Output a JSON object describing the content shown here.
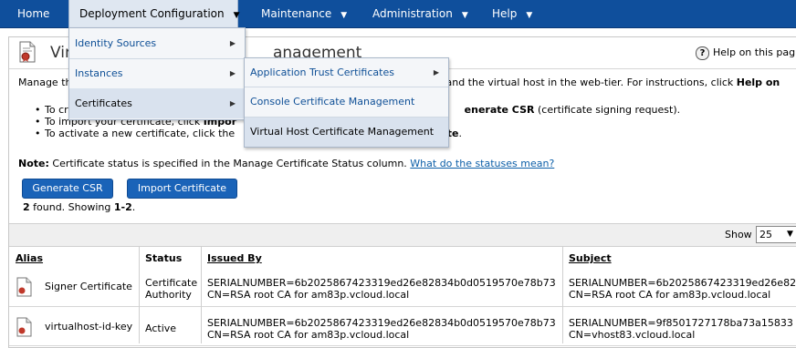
{
  "nav": {
    "items": [
      {
        "label": "Home"
      },
      {
        "label": "Deployment Configuration"
      },
      {
        "label": "Maintenance"
      },
      {
        "label": "Administration"
      },
      {
        "label": "Help"
      }
    ],
    "caret": "▼"
  },
  "menu1": {
    "items": [
      {
        "label": "Identity Sources",
        "arrow": "▶"
      },
      {
        "label": "Instances",
        "arrow": "▶"
      },
      {
        "label": "Certificates",
        "arrow": "▶"
      }
    ]
  },
  "menu2": {
    "items": [
      {
        "label": "Application Trust Certificates",
        "arrow": "▶"
      },
      {
        "label": "Console Certificate Management"
      },
      {
        "label": "Virtual Host Certificate Management"
      }
    ]
  },
  "page": {
    "title_prefix": "Vir",
    "title_suffix": "anagement",
    "help_label": "Help on this pag",
    "help_glyph": "?",
    "intro_prefix": "Manage th",
    "intro_suffix": "and the virtual host in the web-tier. For instructions, click ",
    "intro_bold": "Help on",
    "bullets": [
      {
        "pre": "To cr",
        "bold": "enerate CSR",
        "post": " (certificate signing request)."
      },
      {
        "pre": "To import your certificate, click ",
        "bold": "Impor",
        "post": ""
      },
      {
        "pre": "To activate a new certificate, click the",
        "bold": "vate",
        "post": "."
      }
    ],
    "note_label": "Note:",
    "note_text": " Certificate status is specified in the Manage Certificate Status column. ",
    "note_link": "What do the statuses mean?",
    "btn_generate": "Generate CSR",
    "btn_import": "Import Certificate",
    "found_count": "2",
    "found_text": " found. Showing ",
    "found_range": "1-2",
    "found_end": "."
  },
  "table": {
    "show_label": "Show",
    "show_value": "25",
    "columns": {
      "alias": "Alias",
      "status": "Status",
      "issued_by": "Issued By",
      "subject": "Subject"
    },
    "rows": [
      {
        "alias": "Signer Certificate",
        "status_1": "Certificate",
        "status_2": "Authority",
        "issued_1": "SERIALNUMBER=6b2025867423319ed26e82834b0d0519570e78b73",
        "issued_2": "CN=RSA root CA for am83p.vcloud.local",
        "subject_1": "SERIALNUMBER=6b2025867423319ed26e82",
        "subject_2": "CN=RSA root CA for am83p.vcloud.local"
      },
      {
        "alias": "virtualhost-id-key",
        "status_1": "Active",
        "issued_1": "SERIALNUMBER=6b2025867423319ed26e82834b0d0519570e78b73",
        "issued_2": "CN=RSA root CA for am83p.vcloud.local",
        "subject_1": "SERIALNUMBER=9f8501727178ba73a15833",
        "subject_2": "CN=vhost83.vcloud.local"
      }
    ]
  },
  "colors": {
    "nav_bg": "#0f4f9c",
    "button_bg": "#1a63b8",
    "link": "#0b5ea8"
  }
}
